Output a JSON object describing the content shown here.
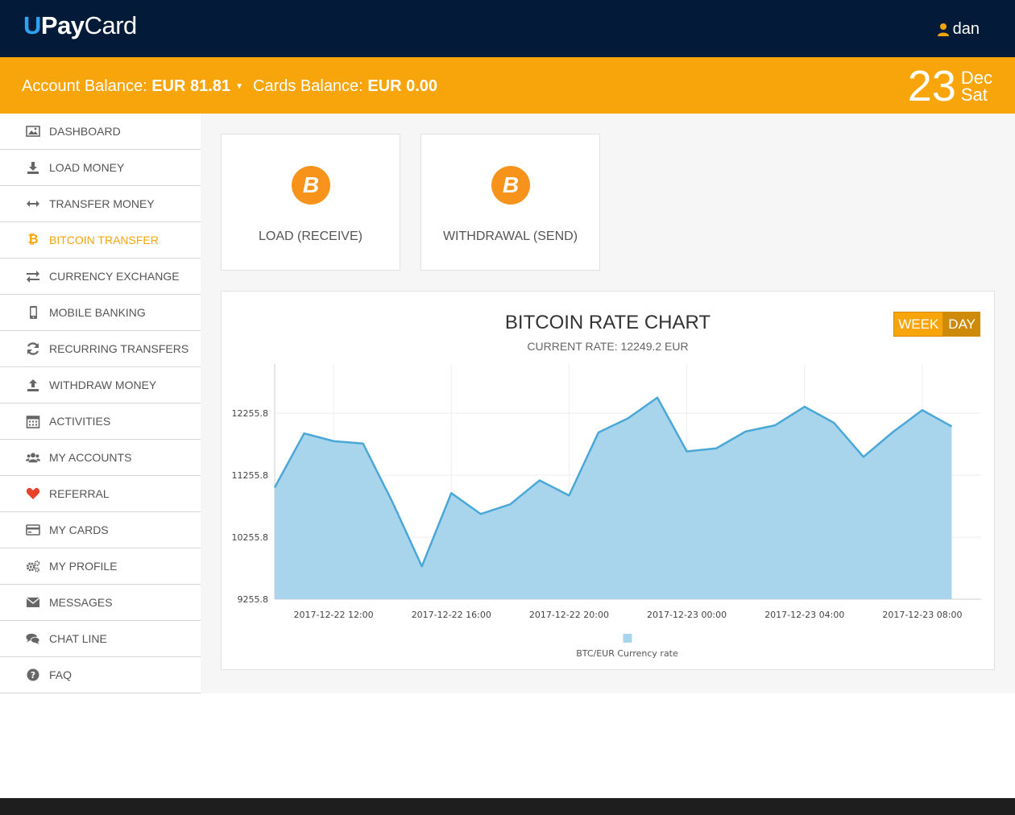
{
  "header": {
    "logo_u": "U",
    "logo_pay": "Pay",
    "logo_card": "Card",
    "user_name": "dan"
  },
  "balance": {
    "account_label": "Account Balance:",
    "account_value": "EUR 81.81",
    "cards_label": "Cards Balance:",
    "cards_value": "EUR 0.00",
    "date_day": "23",
    "date_month": "Dec",
    "date_weekday": "Sat"
  },
  "sidebar": {
    "items": [
      {
        "label": "DASHBOARD",
        "icon": "image-icon"
      },
      {
        "label": "LOAD MONEY",
        "icon": "download-icon"
      },
      {
        "label": "TRANSFER MONEY",
        "icon": "arrows-horizontal-icon"
      },
      {
        "label": "BITCOIN TRANSFER",
        "icon": "bitcoin-icon",
        "active": true
      },
      {
        "label": "CURRENCY EXCHANGE",
        "icon": "exchange-icon"
      },
      {
        "label": "MOBILE BANKING",
        "icon": "mobile-icon"
      },
      {
        "label": "RECURRING TRANSFERS",
        "icon": "refresh-icon"
      },
      {
        "label": "WITHDRAW MONEY",
        "icon": "upload-icon"
      },
      {
        "label": "ACTIVITIES",
        "icon": "calendar-icon"
      },
      {
        "label": "MY ACCOUNTS",
        "icon": "users-icon"
      },
      {
        "label": "REFERRAL",
        "icon": "heart-icon"
      },
      {
        "label": "MY CARDS",
        "icon": "credit-card-icon"
      },
      {
        "label": "MY PROFILE",
        "icon": "gears-icon"
      },
      {
        "label": "MESSAGES",
        "icon": "envelope-icon"
      },
      {
        "label": "CHAT LINE",
        "icon": "comments-icon"
      },
      {
        "label": "FAQ",
        "icon": "question-circle-icon"
      }
    ]
  },
  "actions": {
    "load_label": "LOAD (RECEIVE)",
    "withdraw_label": "WITHDRAWAL (SEND)",
    "coin_symbol": "B"
  },
  "chart": {
    "title": "BITCOIN RATE CHART",
    "subtitle": "CURRENT RATE: 12249.2 EUR",
    "week_label": "WEEK",
    "day_label": "DAY"
  },
  "chart_data": {
    "type": "area",
    "xlabel": "",
    "ylabel": "",
    "ylim": [
      9255.8,
      13050
    ],
    "yticks": [
      9255.8,
      10255.8,
      11255.8,
      12255.8
    ],
    "ytick_labels": [
      "9255.8",
      "10255.8",
      "11255.8",
      "12255.8"
    ],
    "x": [
      "2017-12-22 10:00",
      "2017-12-22 11:00",
      "2017-12-22 12:00",
      "2017-12-22 13:00",
      "2017-12-22 14:00",
      "2017-12-22 15:00",
      "2017-12-22 16:00",
      "2017-12-22 17:00",
      "2017-12-22 18:00",
      "2017-12-22 19:00",
      "2017-12-22 20:00",
      "2017-12-22 21:00",
      "2017-12-22 22:00",
      "2017-12-22 23:00",
      "2017-12-23 00:00",
      "2017-12-23 01:00",
      "2017-12-23 02:00",
      "2017-12-23 03:00",
      "2017-12-23 04:00",
      "2017-12-23 05:00",
      "2017-12-23 06:00",
      "2017-12-23 07:00",
      "2017-12-23 08:00",
      "2017-12-23 09:00",
      "2017-12-23 10:00"
    ],
    "xtick_labels": [
      "2017-12-22 12:00",
      "2017-12-22 16:00",
      "2017-12-22 20:00",
      "2017-12-23 00:00",
      "2017-12-23 04:00",
      "2017-12-23 08:00"
    ],
    "xtick_index": [
      2,
      6,
      10,
      14,
      18,
      22
    ],
    "series": [
      {
        "name": "BTC/EUR Currency rate",
        "color": "#4aa8d8",
        "fill": "#a8d5ec",
        "values": [
          11059,
          11930,
          11806,
          11767,
          10822,
          9785,
          10968,
          10630,
          10787,
          11173,
          10929,
          11946,
          12173,
          12508,
          11640,
          11689,
          11962,
          12061,
          12361,
          12101,
          11552,
          11952,
          12306,
          12042,
          null
        ]
      }
    ],
    "legend": "bottom-center",
    "grid": true
  }
}
